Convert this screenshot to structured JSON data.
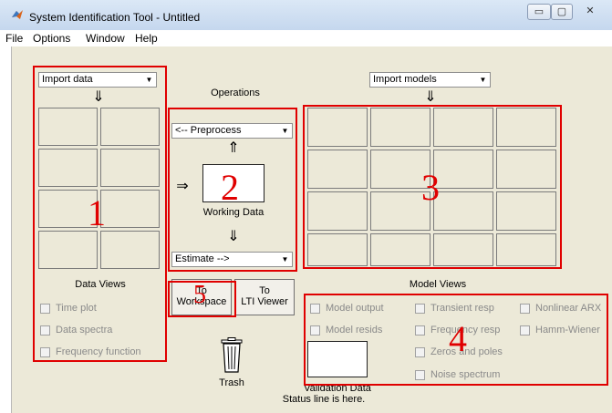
{
  "window": {
    "title": "System Identification Tool - Untitled",
    "minimize_symbol": "▭",
    "maximize_symbol": "▢",
    "close_symbol": "✕"
  },
  "menu": {
    "items": [
      "File",
      "Options",
      "Window",
      "Help"
    ]
  },
  "data_panel": {
    "select_value": "Import data",
    "down_arrow": "⇓",
    "title": "Data Views",
    "checkboxes": [
      "Time plot",
      "Data spectra",
      "Frequency function"
    ],
    "annotation": "1"
  },
  "operations": {
    "title": "Operations",
    "preprocess_value": "<-- Preprocess",
    "up_arrow": "⇑",
    "down_arrow": "⇓",
    "right_arrow": "⇒",
    "working_data_label": "Working Data",
    "estimate_value": "Estimate -->",
    "annotation": "2"
  },
  "models_panel": {
    "select_value": "Import models",
    "down_arrow": "⇓",
    "annotation": "3"
  },
  "buttons": {
    "to_workspace_line1": "To",
    "to_workspace_line2": "Workspace",
    "to_lti_line1": "To",
    "to_lti_line2": "LTI Viewer",
    "to_workspace_annotation": "5"
  },
  "trash": {
    "label": "Trash"
  },
  "model_views": {
    "title": "Model Views",
    "checkboxes": {
      "model_output": "Model output",
      "model_resids": "Model resids",
      "transient_resp": "Transient resp",
      "frequency_resp": "Frequency resp",
      "zeros_and_poles": "Zeros and poles",
      "noise_spectrum": "Noise spectrum",
      "nonlinear_arx": "Nonlinear ARX",
      "hamm_wiener": "Hamm-Wiener"
    },
    "validation_label": "Validation Data",
    "annotation": "4"
  },
  "status": {
    "text": "Status line is here."
  },
  "colors": {
    "annotation_red": "#e00000",
    "panel_bg": "#ece9d8"
  }
}
